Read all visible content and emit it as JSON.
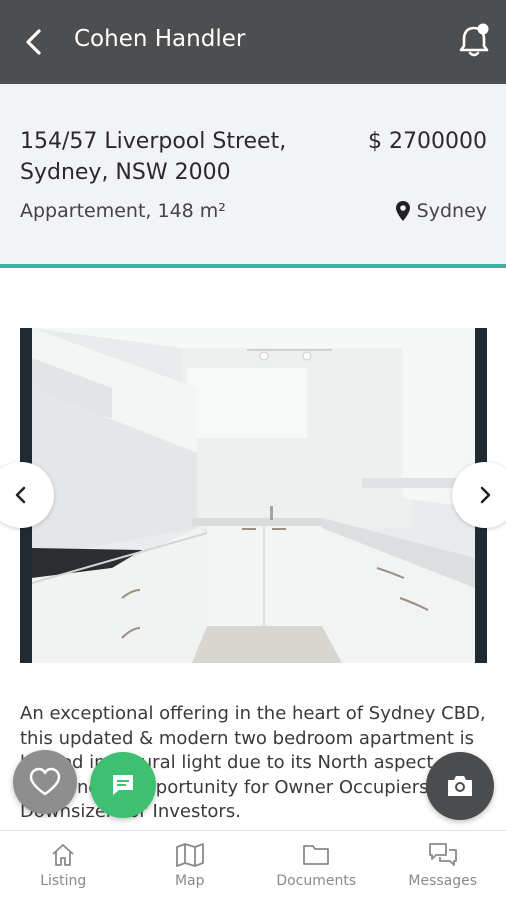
{
  "header": {
    "title": "Cohen Handler",
    "back_icon": "arrow-left-icon",
    "notification_icon": "bell-icon"
  },
  "listing": {
    "address_line1": "154/57 Liverpool Street,",
    "address_line2": "Sydney, NSW 2000",
    "price": "$ 2700000",
    "property_type": "Appartement, 148 m²",
    "location": "Sydney",
    "accent_color": "#36b3a2"
  },
  "gallery": {
    "prev_icon": "chevron-left-icon",
    "next_icon": "chevron-right-icon"
  },
  "description": "An exceptional offering in the heart of Sydney CBD, this updated & modern two bedroom apartment is bathed in natural light due to its North aspect. An outstanding opportunity for Owner Occupiers, Downsizers or Investors.",
  "fabs": {
    "like_icon": "heart-icon",
    "chat_icon": "chat-icon",
    "camera_icon": "camera-icon",
    "chat_color": "#3fbf72"
  },
  "tabs": [
    {
      "label": "Listing",
      "icon": "home-icon"
    },
    {
      "label": "Map",
      "icon": "map-icon"
    },
    {
      "label": "Documents",
      "icon": "folder-icon"
    },
    {
      "label": "Messages",
      "icon": "messages-icon"
    }
  ]
}
